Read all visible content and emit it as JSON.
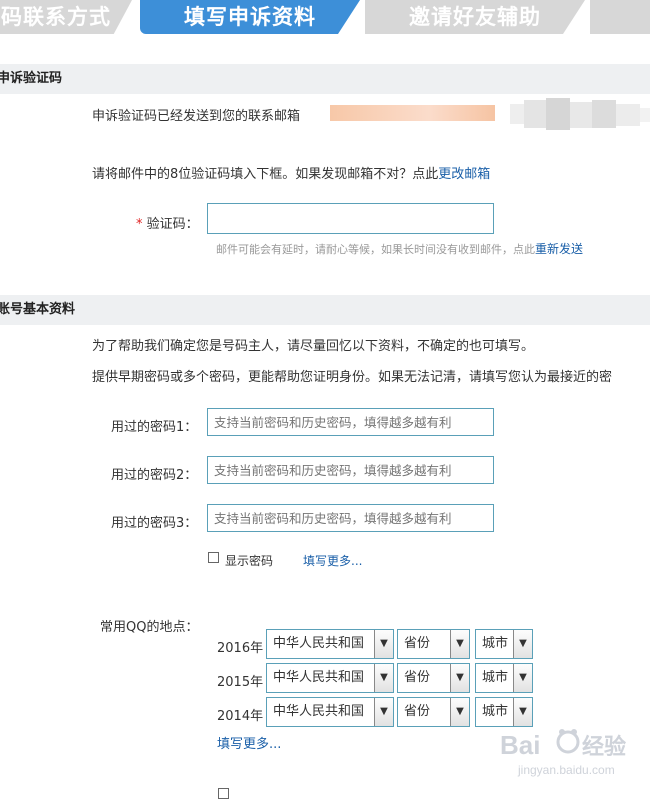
{
  "steps": [
    {
      "label": "码联系方式",
      "state": "done"
    },
    {
      "label": "填写申诉资料",
      "state": "active"
    },
    {
      "label": "邀请好友辅助",
      "state": "todo"
    },
    {
      "label": "",
      "state": "todo"
    }
  ],
  "verify": {
    "section_title": "申诉验证码",
    "sent_text": "申诉验证码已经发送到您的联系邮箱",
    "instruction": "请将邮件中的8位验证码填入下框。如果发现邮箱不对？点此",
    "change_email_link": "更改邮箱",
    "required_mark": "*",
    "code_label": "验证码：",
    "code_value": "",
    "hint": "邮件可能会有延时，请耐心等候，如果长时间没有收到邮件，点此",
    "resend_link": "重新发送"
  },
  "account": {
    "section_title": "账号基本资料",
    "intro1": "为了帮助我们确定您是号码主人，请尽量回忆以下资料，不确定的也可填写。",
    "intro2": "提供早期密码或多个密码，更能帮助您证明身份。如果无法记清，请填写您认为最接近的密",
    "passwords": [
      {
        "label": "用过的密码1：",
        "placeholder": "支持当前密码和历史密码，填得越多越有利"
      },
      {
        "label": "用过的密码2：",
        "placeholder": "支持当前密码和历史密码，填得越多越有利"
      },
      {
        "label": "用过的密码3：",
        "placeholder": "支持当前密码和历史密码，填得越多越有利"
      }
    ],
    "show_password_label": "显示密码",
    "fill_more_link": "填写更多...",
    "location_label": "常用QQ的地点：",
    "locations": [
      {
        "year": "2016年",
        "country": "中华人民共和国",
        "province": "省份",
        "city": "城市"
      },
      {
        "year": "2015年",
        "country": "中华人民共和国",
        "province": "省份",
        "city": "城市"
      },
      {
        "year": "2014年",
        "country": "中华人民共和国",
        "province": "省份",
        "city": "城市"
      }
    ],
    "location_more_link": "填写更多..."
  },
  "colors": {
    "step_active": "#3d8fd8",
    "step_inactive": "#d7d7d7",
    "link": "#1a5fa8",
    "required": "#e02020",
    "section_bar": "#eef0f2"
  }
}
